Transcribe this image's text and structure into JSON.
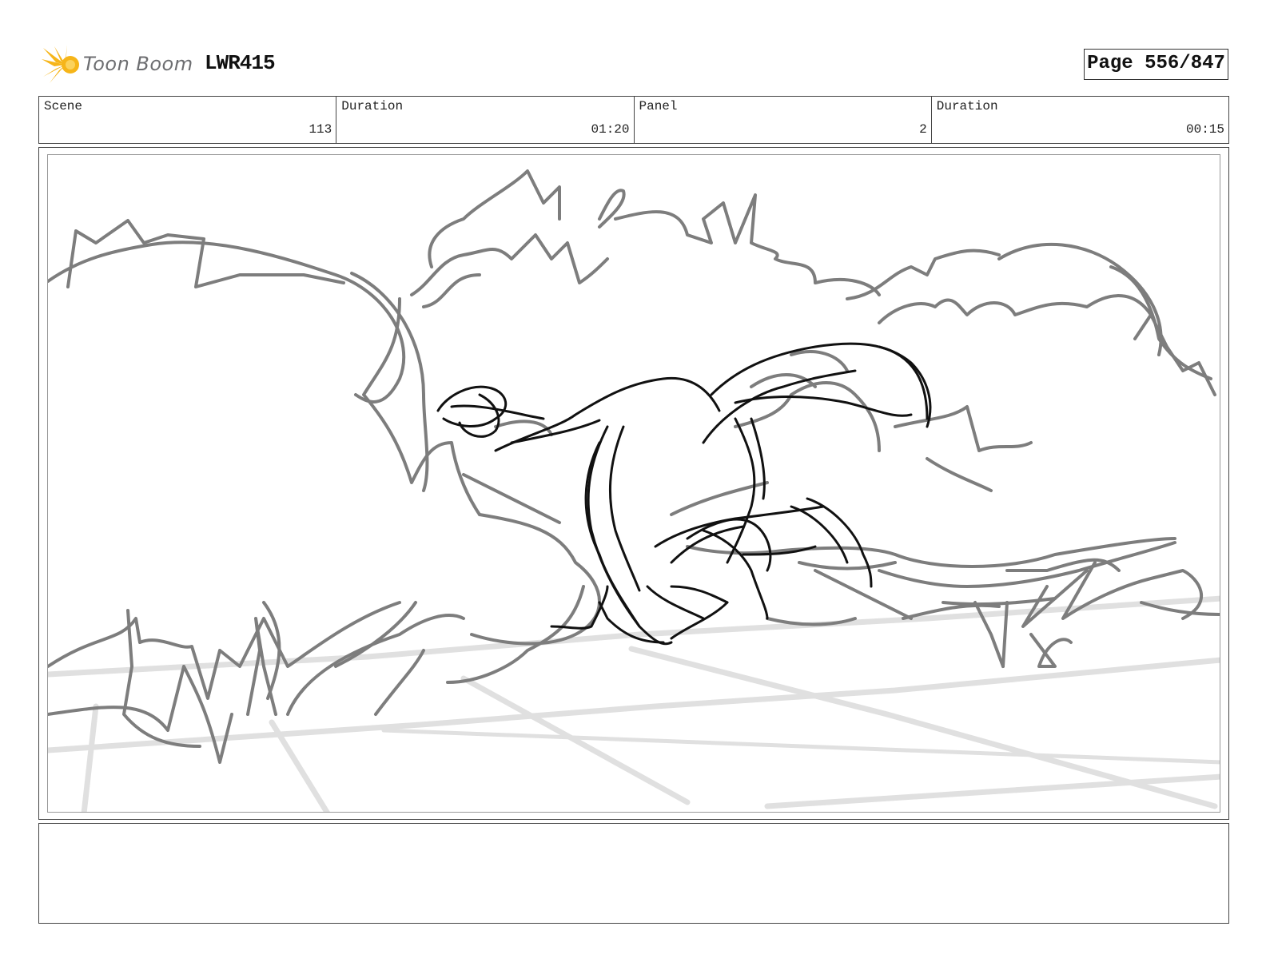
{
  "header": {
    "logo_text": "Toon Boom",
    "project_code": "LWR415",
    "page_label": "Page 556/847"
  },
  "info": [
    {
      "label": "Scene",
      "value": "113"
    },
    {
      "label": "Duration",
      "value": "01:20"
    },
    {
      "label": "Panel",
      "value": "2"
    },
    {
      "label": "Duration",
      "value": "00:15"
    }
  ],
  "panel": {
    "sketch": "storyboard-drawing"
  },
  "notes": {
    "text": ""
  }
}
